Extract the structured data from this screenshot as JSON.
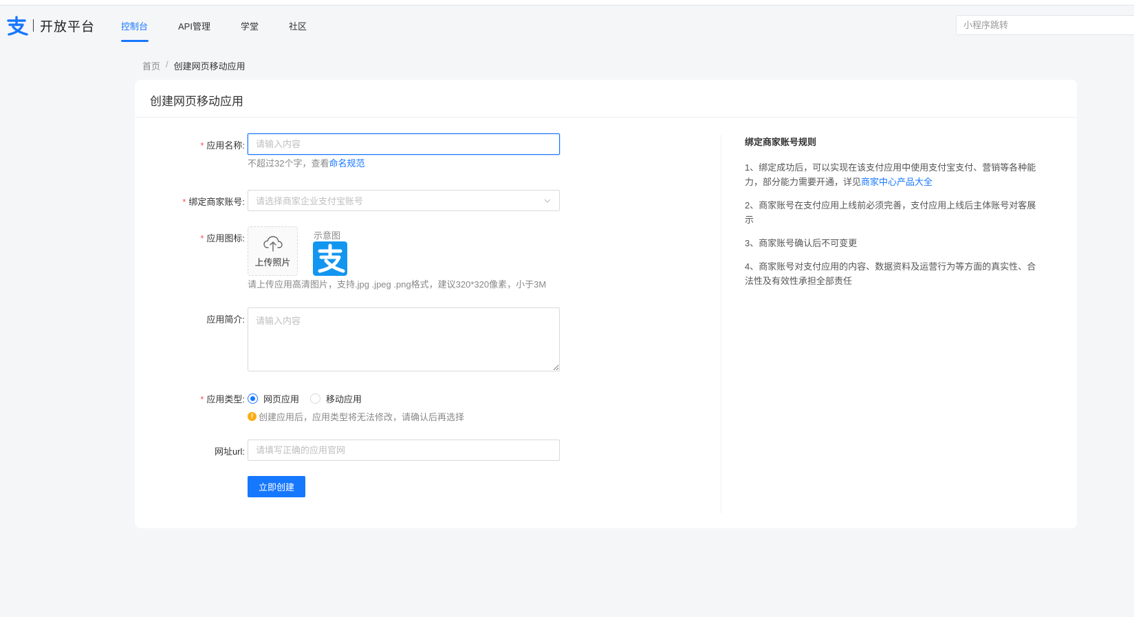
{
  "header": {
    "logo_text": "开放平台",
    "nav": [
      {
        "label": "控制台",
        "active": true
      },
      {
        "label": "API管理",
        "active": false
      },
      {
        "label": "学堂",
        "active": false
      },
      {
        "label": "社区",
        "active": false
      }
    ],
    "search_placeholder": "小程序跳转"
  },
  "breadcrumb": {
    "home": "首页",
    "separator": "/",
    "current": "创建网页移动应用"
  },
  "page": {
    "title": "创建网页移动应用"
  },
  "form": {
    "app_name": {
      "required_mark": "*",
      "label": "应用名称:",
      "placeholder": "请输入内容",
      "hint_prefix": "不超过32个字，查看",
      "hint_link": "命名规范"
    },
    "merchant": {
      "required_mark": "*",
      "label": "绑定商家账号:",
      "placeholder": "请选择商家企业支付宝账号"
    },
    "icon": {
      "required_mark": "*",
      "label": "应用图标:",
      "upload_label": "上传照片",
      "sample_label": "示意图",
      "hint": "请上传应用高清图片，支持.jpg .jpeg .png格式，建议320*320像素，小于3M"
    },
    "intro": {
      "label": "应用简介:",
      "placeholder": "请输入内容"
    },
    "app_type": {
      "required_mark": "*",
      "label": "应用类型:",
      "options": [
        {
          "label": "网页应用",
          "checked": true
        },
        {
          "label": "移动应用",
          "checked": false
        }
      ],
      "warning_icon": "!",
      "warning": "创建应用后，应用类型将无法修改，请确认后再选择"
    },
    "url": {
      "label": "网址url:",
      "placeholder": "请填写正确的应用官网"
    },
    "submit_label": "立即创建"
  },
  "rules": {
    "title": "绑定商家账号规则",
    "item1_text": "1、绑定成功后，可以实现在该支付应用中使用支付宝支付、营销等各种能力，部分能力需要开通，详见",
    "item1_link": "商家中心产品大全",
    "item2": "2、商家账号在支付应用上线前必须完善，支付应用上线后主体账号对客展示",
    "item3": "3、商家账号确认后不可变更",
    "item4": "4、商家账号对支付应用的内容、数据资料及运营行为等方面的真实性、合法性及有效性承担全部责任"
  },
  "colors": {
    "primary": "#1677ff",
    "required": "#ff4d4f",
    "warning": "#faad14",
    "page_bg": "#f5f6f8"
  }
}
